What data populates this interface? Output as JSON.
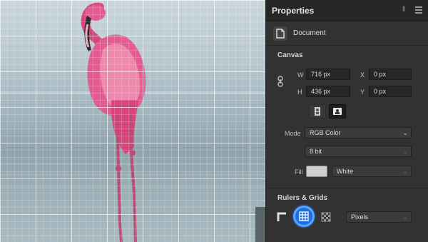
{
  "panel": {
    "title": "Properties",
    "document_label": "Document"
  },
  "canvas_section": {
    "title": "Canvas",
    "width_label": "W",
    "width_value": "716 px",
    "height_label": "H",
    "height_value": "436 px",
    "x_label": "X",
    "x_value": "0 px",
    "y_label": "Y",
    "y_value": "0 px",
    "mode_label": "Mode",
    "mode_value": "RGB Color",
    "bit_depth_value": "8 bit",
    "fill_label": "Fill",
    "fill_value": "White",
    "fill_color": "#cfcfcf"
  },
  "rulers_section": {
    "title": "Rulers & Grids",
    "units_value": "Pixels"
  },
  "colors": {
    "accent": "#1e6fe0",
    "panel_bg": "#323232",
    "header_bg": "#262626",
    "flamingo": "#e04a86"
  },
  "icons": [
    "collapse-icon",
    "menu-icon",
    "document-icon",
    "link-icon",
    "portrait-icon",
    "landscape-icon",
    "ruler-icon",
    "grid-icon",
    "pixel-grid-icon",
    "chevron-down-icon"
  ]
}
